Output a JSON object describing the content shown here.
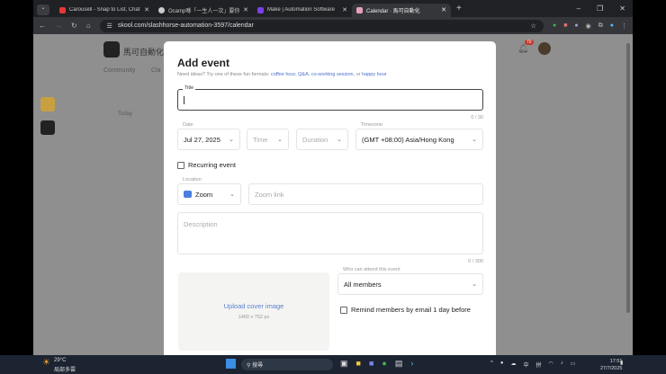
{
  "browser": {
    "tabs": [
      {
        "label": "Carousell - Snap to List, Chat",
        "color": "#e53935"
      },
      {
        "label": "Ocamp喺「一生人一次」要你",
        "color": "#cccccc"
      },
      {
        "label": "Make | Automation Software",
        "color": "#7b3fe4"
      },
      {
        "label": "Calendar · 馬可自動化",
        "color": "#e8a0c0",
        "active": true
      }
    ],
    "url": "skool.com/slashhorse-automation-3597/calendar"
  },
  "background": {
    "group_name": "馬可自動化",
    "nav": [
      "Community",
      "Cla"
    ],
    "today": "Today",
    "notification_count": "70"
  },
  "modal": {
    "title": "Add event",
    "ideas_prefix": "Need ideas? Try one of these fun formats:",
    "ideas_links": [
      "coffee hour",
      "Q&A",
      "co-working session",
      "happy hour"
    ],
    "ideas_or": ", or",
    "title_label": "Title",
    "title_value": "",
    "title_count": "0 / 30",
    "date_label": "Date",
    "date_value": "Jul 27, 2025",
    "time_placeholder": "Time",
    "duration_placeholder": "Duration",
    "timezone_label": "Timezone",
    "timezone_value": "(GMT +08:00) Asia/Hong Kong",
    "recurring_label": "Recurring event",
    "recurring_checked": false,
    "location_label": "Location",
    "location_value": "Zoom",
    "zoom_link_placeholder": "Zoom link",
    "description_placeholder": "Description",
    "description_count": "0 / 300",
    "upload_label": "Upload cover image",
    "upload_size": "1460 x 752 px",
    "attend_label": "Who can attend this event",
    "attend_value": "All members",
    "remind_label": "Remind members by email 1 day before",
    "remind_checked": false
  },
  "taskbar": {
    "weather_temp": "29°C",
    "weather_desc": "局部多雲",
    "search_placeholder": "搜尋",
    "ime1": "中",
    "ime2": "拼",
    "time": "17:51",
    "date": "27/7/2025"
  }
}
